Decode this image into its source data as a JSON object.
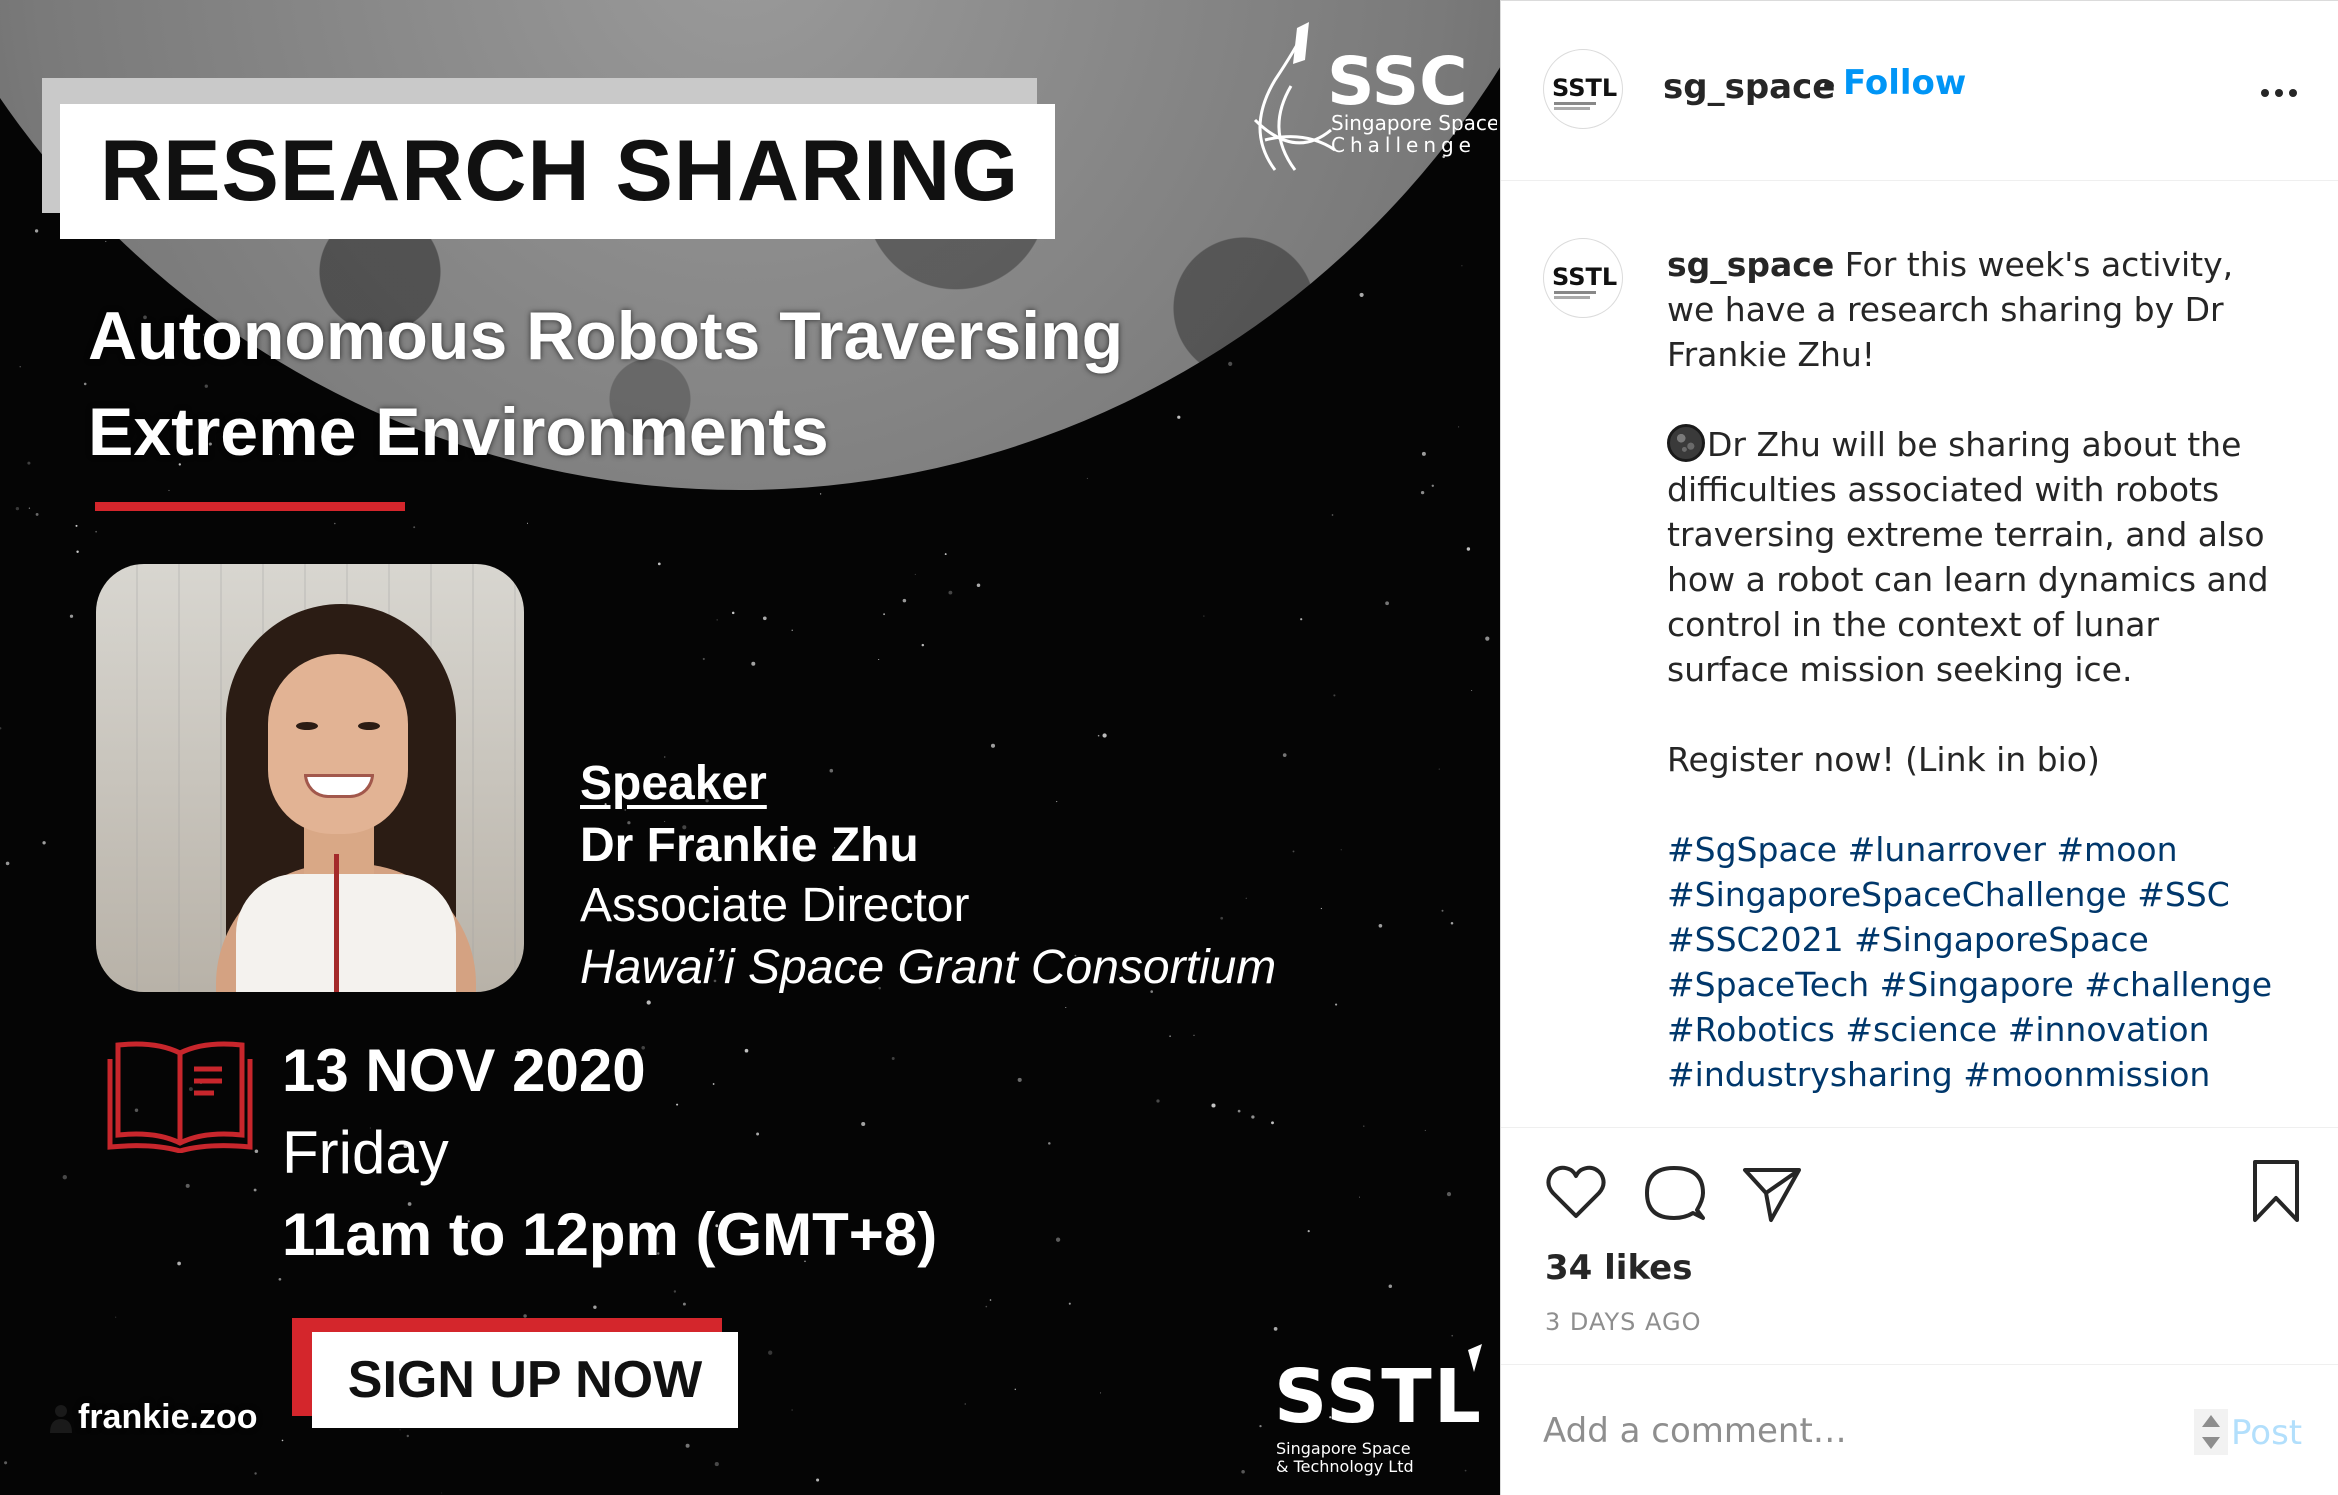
{
  "poster": {
    "title": "RESEARCH SHARING",
    "subtitle_line1": "Autonomous Robots Traversing",
    "subtitle_line2": "Extreme Environments",
    "speaker_heading": "Speaker",
    "speaker_name": "Dr Frankie Zhu",
    "speaker_role": "Associate Director",
    "speaker_org": "Hawai’i Space Grant Consortium",
    "event_date": "13 NOV 2020",
    "event_day": "Friday",
    "event_time": "11am to 12pm (GMT+8)",
    "signup_label": "SIGN UP NOW",
    "ssc_logo_text": "SSC",
    "ssc_logo_sub1": "Singapore Space",
    "ssc_logo_sub2": "Challenge",
    "sstl_logo_text": "SSTL",
    "sstl_logo_sub1": "Singapore Space",
    "sstl_logo_sub2": "& Technology Ltd",
    "tagged_user": "frankie.zoo",
    "accent_red": "#d4262c"
  },
  "header": {
    "username": "sg_space",
    "separator": "•",
    "follow_label": "Follow",
    "more_icon": "more-horizontal-icon",
    "avatar_text": "SSTL"
  },
  "caption": {
    "username": "sg_space",
    "line1": " For this week's activity, we have a research sharing by Dr Frankie Zhu!",
    "para2": "Dr Zhu will be sharing about the difficulties associated with robots traversing extreme terrain, and also how a robot can learn dynamics and control in the context of lunar surface mission seeking ice.",
    "para3": "Register now! (Link in bio)",
    "hashtags": [
      "#SgSpace",
      "#lunarrover",
      "#moon",
      "#SingaporeSpaceChallenge",
      "#SSC",
      "#SSC2021",
      "#SingaporeSpace",
      "#SpaceTech",
      "#Singapore",
      "#challenge",
      "#Robotics",
      "#science",
      "#innovation",
      "#industrysharing",
      "#moonmission"
    ]
  },
  "actions": {
    "likes": "34 likes",
    "date": "3 DAYS AGO"
  },
  "comment_bar": {
    "placeholder": "Add a comment…",
    "post_label": "Post"
  },
  "colors": {
    "link_blue": "#0095f6",
    "hashtag_blue": "#00376b",
    "muted_gray": "#8e8e8e"
  }
}
